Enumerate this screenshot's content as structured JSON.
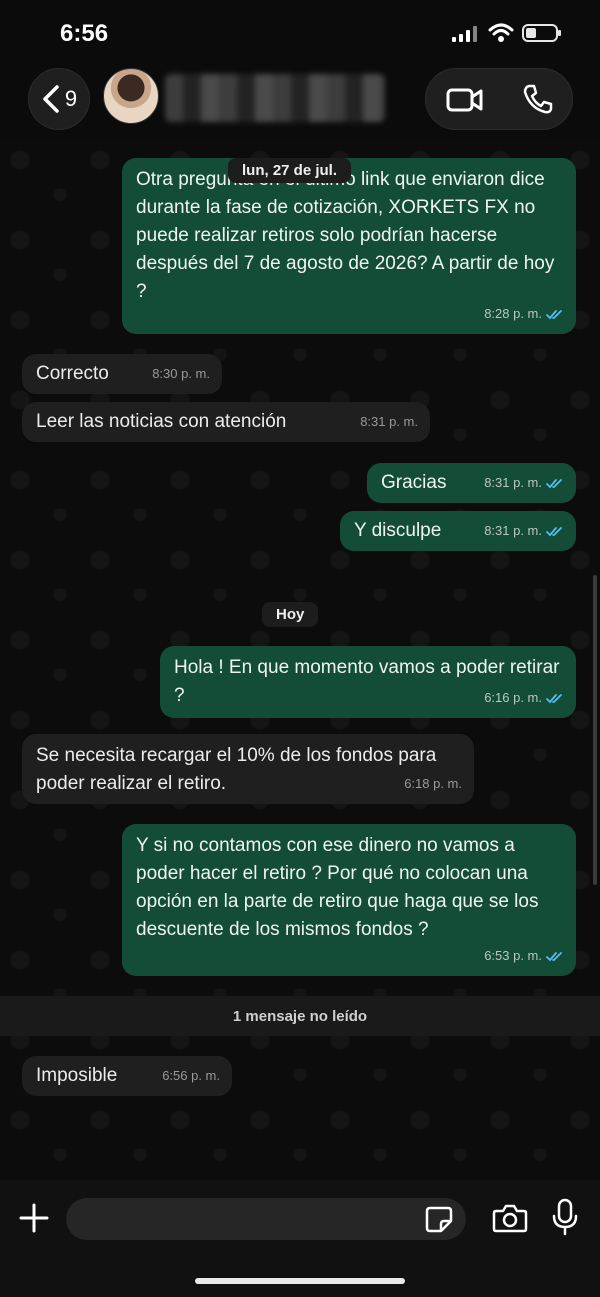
{
  "status_bar": {
    "time": "6:56"
  },
  "header": {
    "back_count": "9"
  },
  "date_chips": {
    "first": "lun, 27 de jul.",
    "today": "Hoy"
  },
  "messages": [
    {
      "dir": "out",
      "text": "Otra pregunta en el último link que enviaron dice durante la fase de cotización, XORKETS FX no puede realizar retiros solo podrían hacerse después del 7 de agosto de 2026? A partir de hoy ?",
      "time": "8:28 p. m."
    },
    {
      "dir": "in",
      "text": "Correcto",
      "time": "8:30 p. m."
    },
    {
      "dir": "in",
      "text": "Leer las noticias con atención",
      "time": "8:31 p. m."
    },
    {
      "dir": "out",
      "text": "Gracias",
      "time": "8:31 p. m."
    },
    {
      "dir": "out",
      "text": "Y disculpe",
      "time": "8:31 p. m."
    },
    {
      "dir": "out",
      "text": "Hola ! En que momento vamos a poder retirar ?",
      "time": "6:16 p. m."
    },
    {
      "dir": "in",
      "text": "Se necesita recargar el 10% de los fondos para poder realizar el retiro.",
      "time": "6:18 p. m."
    },
    {
      "dir": "out",
      "text": "Y si no contamos con ese dinero no vamos a poder hacer el retiro ? Por qué no colocan una opción en la parte de retiro que haga que se los descuente de los mismos fondos ?",
      "time": "6:53 p. m."
    },
    {
      "dir": "in",
      "text": "Imposible",
      "time": "6:56 p. m."
    }
  ],
  "unread_banner": "1 mensaje no leído",
  "composer": {
    "placeholder": ""
  },
  "icons": [
    "back-chevron-icon",
    "video-call-icon",
    "phone-icon",
    "plus-icon",
    "sticker-icon",
    "camera-icon",
    "mic-icon",
    "double-check-icon"
  ],
  "colors": {
    "outgoing_bubble": "#144d37",
    "incoming_bubble": "#1f1f1f",
    "read_ticks": "#53bdeb"
  }
}
